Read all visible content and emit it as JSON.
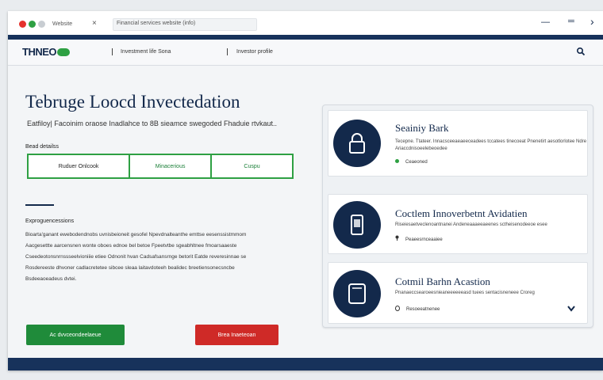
{
  "window": {
    "tab_label": "Website",
    "tab_close": "×",
    "address": "Financial services website (info)",
    "controls": {
      "minus": "—",
      "lines": "═",
      "next": "›"
    }
  },
  "nav": {
    "logo": "THNEO",
    "items": [
      "Investment life Sona",
      "Investor profile"
    ],
    "search_icon": "magnifier"
  },
  "hero": {
    "title": "Tebruge Loocd Invectedation",
    "subtitle": "Eatfiloy| Facoinim oraose Inadlahce to 8B sieamce swegoded Fhaduie rtvkaut.."
  },
  "options": {
    "heading": "Bead detailss",
    "tabs": [
      "Ruduer Onlcook",
      "Minacerious",
      "Cuspu"
    ]
  },
  "about": {
    "heading": "Exproguencessions",
    "lines": [
      "Bioarta'ganant ewebodendnobs uvnisbeioneit gesofel Npevdnalteanthe emttse eesenssistmmom",
      "Aacgesettte aarcensnen wonte oboes ednoe bel betoe Fpeetvtbe sgeabhltnee fmoarsaaeste",
      "Cseedeotonsnrnssseelvioniiie etiee Odnonit hvan Cadsafsansrnge betorit Eatde reveresinnae se",
      "Rosdereeste dhvoner cadlacretetee sibcee sleaa laitavdoteeh bealidec breetiensonecsncbe",
      "Bsdeeaoeadeus dvtei."
    ]
  },
  "buttons": {
    "primary": "Ac dvvceondeelaeue",
    "secondary": "Brea Inaeteoan"
  },
  "cards": [
    {
      "title": "Seainiy Bark",
      "desc": "Tecepne. Ttateer. Innacsceeaeaeeceadees tccatees tinecoeat Pnenetirt aesotlorlotee Ndre",
      "sub": "Ariaccdnisoeelebeoedee",
      "status": "Ceaeoned",
      "icon": "lock-icon",
      "status_marker": "green-dot"
    },
    {
      "title": "Coctlem Innoverbetnt Avidatien",
      "desc": "Riseiesaetveclenoantnanei Andeneaaaeeaeenes sctheisenodeeoe esee",
      "sub": "",
      "status": "Peaeesrnceaaiee",
      "icon": "phone-icon",
      "status_marker": "pin"
    },
    {
      "title": "Cotmil Barhn Acastion",
      "desc": "Pnanaeccsearoeesnieaneeeeeeasd tuees sentacisneneee Croreg",
      "sub": "",
      "status": "Resoeeatnenee",
      "icon": "tablet-icon",
      "status_marker": "ring",
      "action": "chevron"
    }
  ],
  "colors": {
    "navy": "#13294b",
    "green": "#2ea043",
    "red": "#cf2a27"
  }
}
